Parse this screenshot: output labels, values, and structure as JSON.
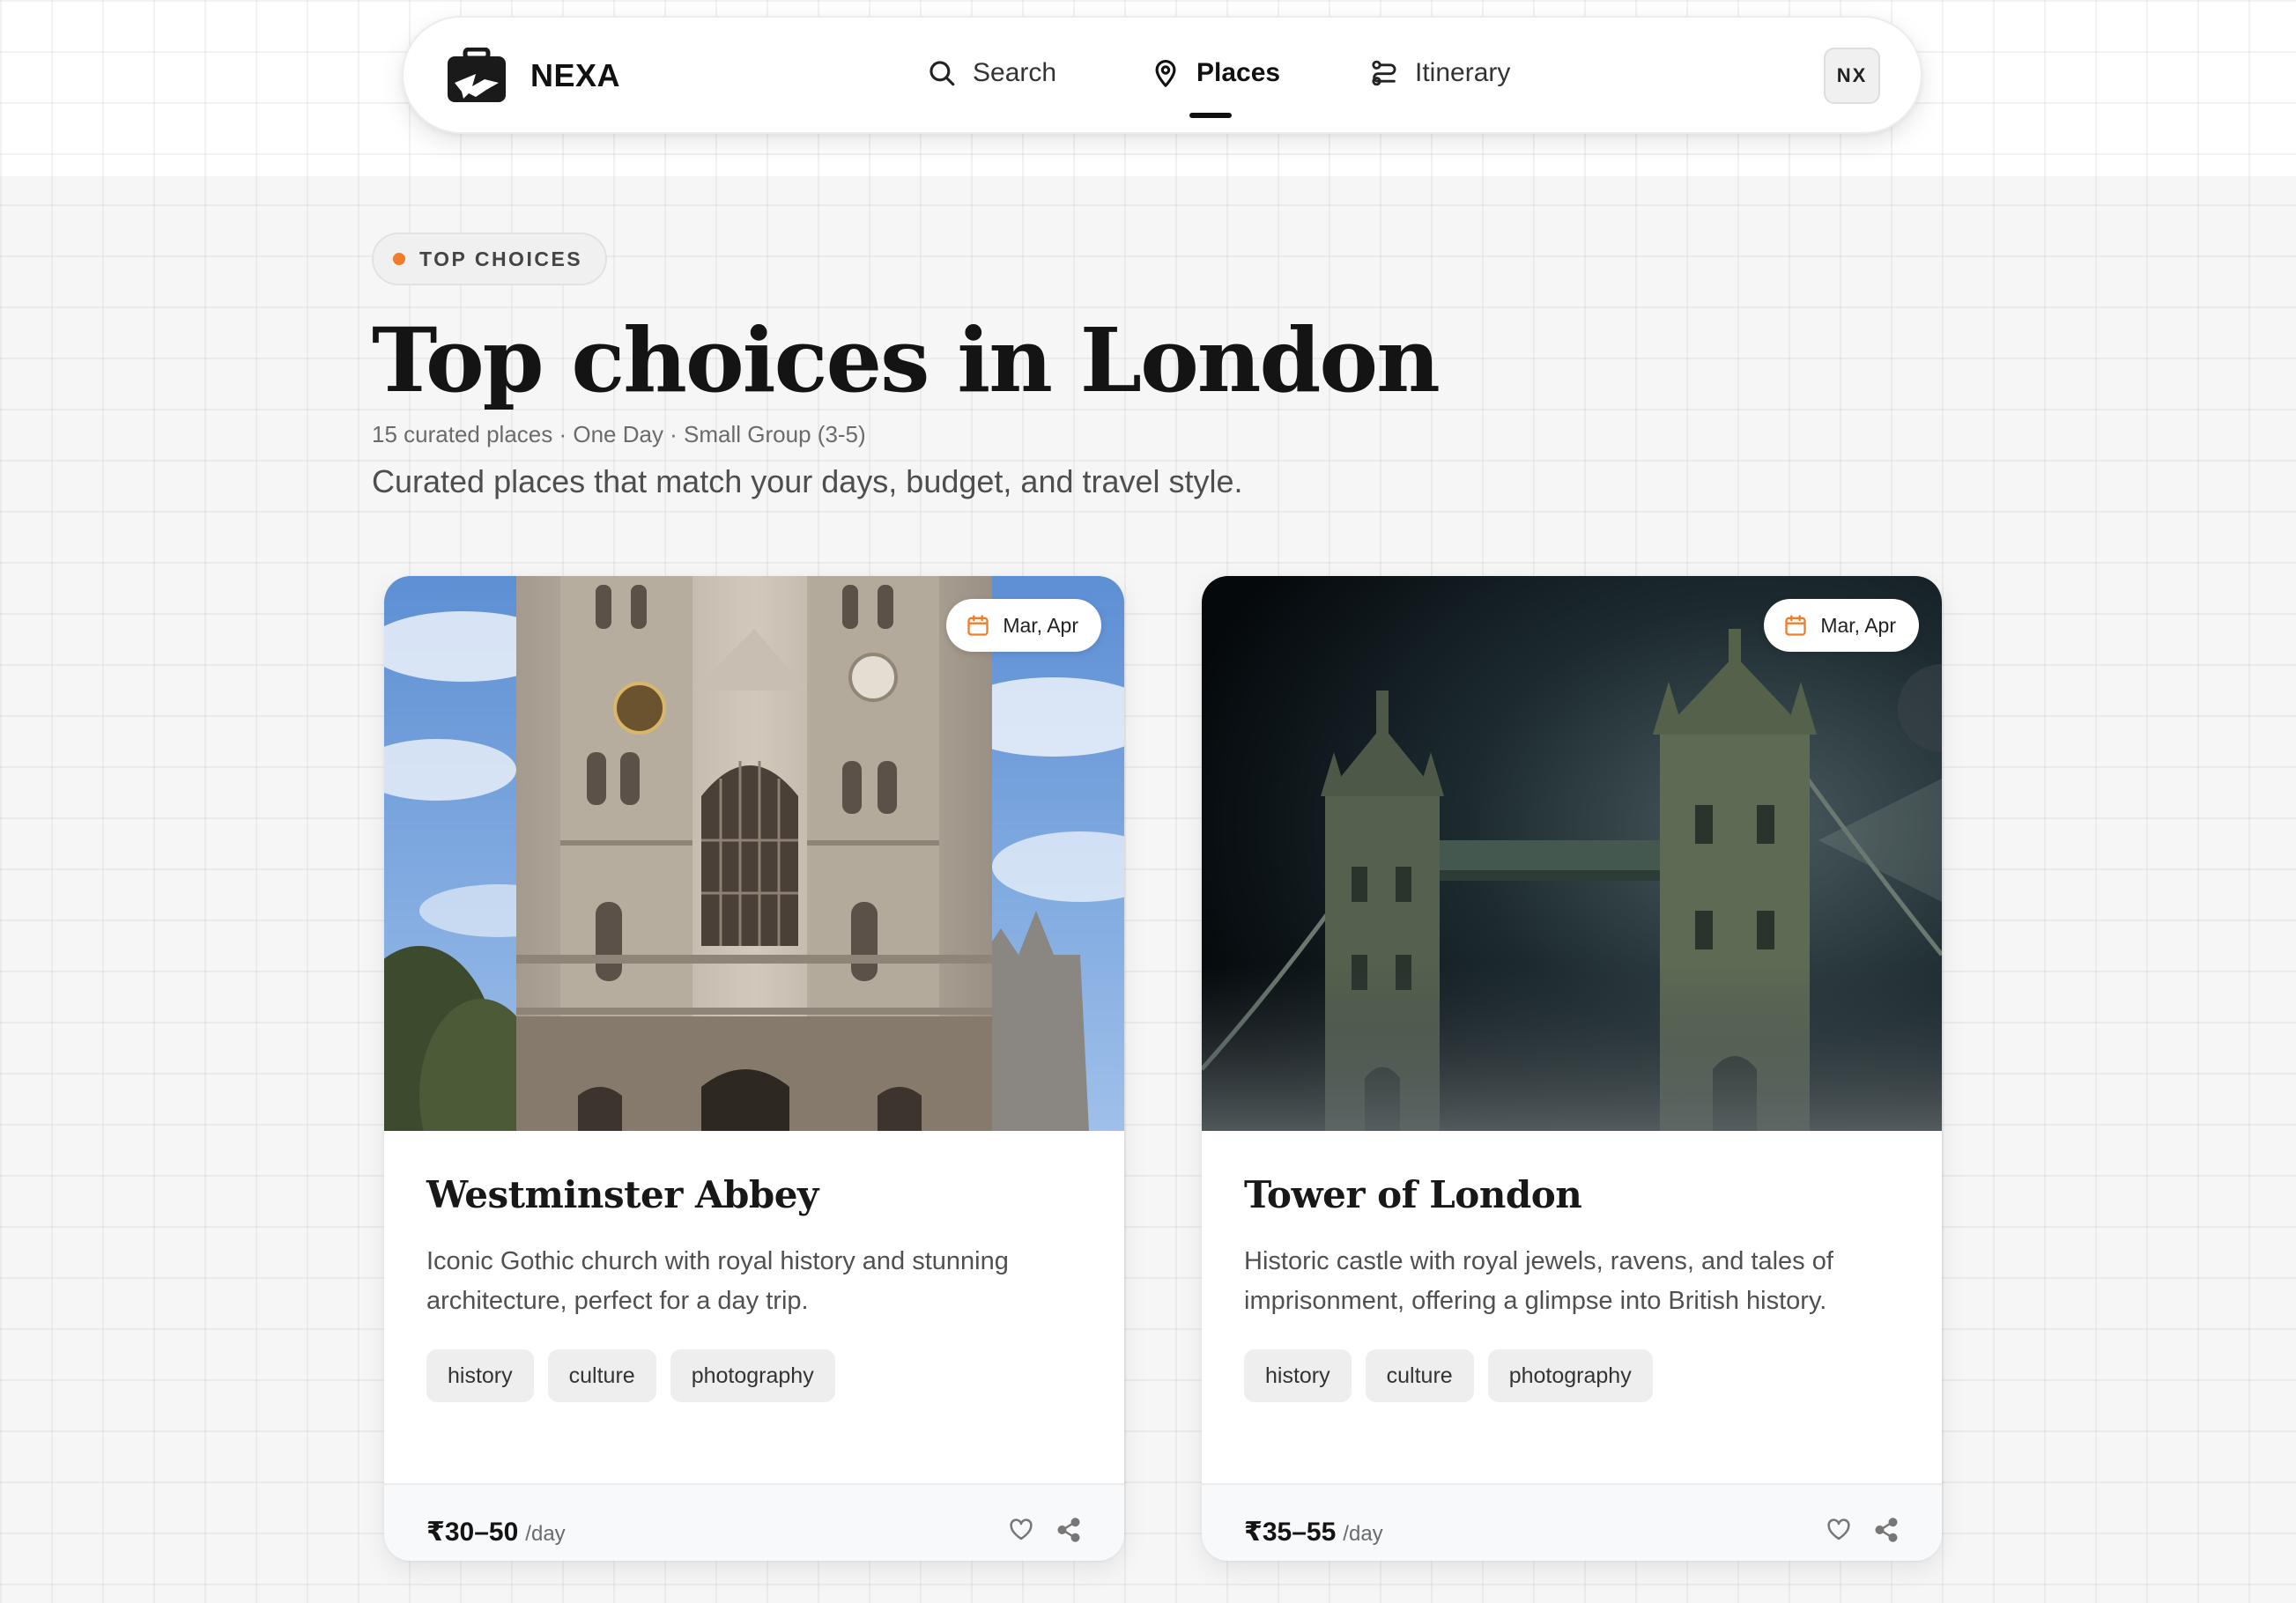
{
  "app": {
    "brand": "NEXA",
    "avatar_initials": "NX"
  },
  "nav": {
    "items": [
      {
        "label": "Search",
        "icon": "search-icon"
      },
      {
        "label": "Places",
        "icon": "map-pin-icon",
        "active": true
      },
      {
        "label": "Itinerary",
        "icon": "route-icon"
      }
    ]
  },
  "hero": {
    "pill": "TOP CHOICES",
    "title": "Top choices in London",
    "meta": "15 curated places · One Day · Small Group (3-5)",
    "subtitle": "Curated places that match your days, budget, and travel style."
  },
  "cards": [
    {
      "date": "Mar, Apr",
      "title": "Westminster Abbey",
      "description": "Iconic Gothic church with royal history and stunning architecture, perfect for a day trip.",
      "tags": [
        "history",
        "culture",
        "photography"
      ],
      "price": "₹30–50",
      "price_unit": "/day"
    },
    {
      "date": "Mar, Apr",
      "title": "Tower of London",
      "description": "Historic castle with royal jewels, ravens, and tales of imprisonment, offering a glimpse into British history.",
      "tags": [
        "history",
        "culture",
        "photography"
      ],
      "price": "₹35–55",
      "price_unit": "/day"
    }
  ],
  "colors": {
    "accent": "#f07c2c",
    "text": "#141414",
    "muted": "#6b6b6b"
  }
}
